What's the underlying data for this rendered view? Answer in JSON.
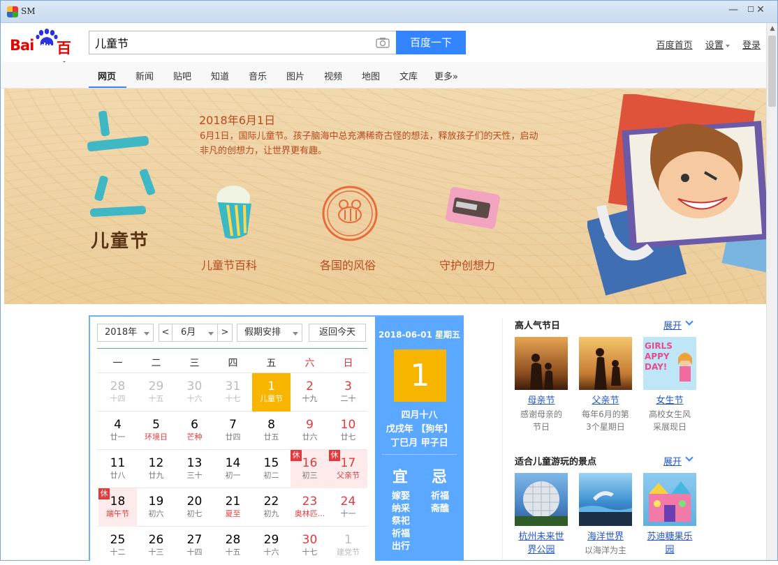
{
  "window": {
    "title": "SM",
    "min": "—",
    "max": "☐",
    "close": "✕"
  },
  "header": {
    "logo": {
      "text_bai": "Bai",
      "text_du": "du",
      "text_cn": "百度"
    },
    "search": {
      "value": "儿童节",
      "button": "百度一下"
    },
    "links": [
      "百度首页",
      "设置",
      "登录"
    ]
  },
  "nav": {
    "tabs": [
      "网页",
      "新闻",
      "贴吧",
      "知道",
      "音乐",
      "图片",
      "视频",
      "地图",
      "文库",
      "更多»"
    ]
  },
  "banner": {
    "date": "2018年6月1日",
    "desc": "6月1日，国际儿童节。孩子脑海中总充满稀奇古怪的想法，释放孩子们的天性，启动非凡的创想力，让世界更有趣。",
    "title": "儿童节",
    "links": [
      "儿童节百科",
      "各国的风俗",
      "守护创想力"
    ]
  },
  "calendar": {
    "year": "2018年",
    "prev": "<",
    "month": "6月",
    "next": ">",
    "holiday": "假期安排",
    "today_btn": "返回今天",
    "weekdays": [
      "一",
      "二",
      "三",
      "四",
      "五",
      "六",
      "日"
    ],
    "rest_mark": "休",
    "weeks": [
      [
        {
          "n": "28",
          "l": "十四",
          "t": "muted"
        },
        {
          "n": "29",
          "l": "十五",
          "t": "muted"
        },
        {
          "n": "30",
          "l": "十六",
          "t": "muted"
        },
        {
          "n": "31",
          "l": "十七",
          "t": "muted"
        },
        {
          "n": "1",
          "l": "儿童节",
          "t": "today"
        },
        {
          "n": "2",
          "l": "十九",
          "t": "weekend"
        },
        {
          "n": "3",
          "l": "二十",
          "t": "weekend"
        }
      ],
      [
        {
          "n": "4",
          "l": "廿一"
        },
        {
          "n": "5",
          "l": "环境日",
          "red": true
        },
        {
          "n": "6",
          "l": "芒种",
          "red": true
        },
        {
          "n": "7",
          "l": "廿四"
        },
        {
          "n": "8",
          "l": "廿五"
        },
        {
          "n": "9",
          "l": "廿六",
          "t": "weekend"
        },
        {
          "n": "10",
          "l": "廿七",
          "t": "weekend"
        }
      ],
      [
        {
          "n": "11",
          "l": "廿八"
        },
        {
          "n": "12",
          "l": "廿九"
        },
        {
          "n": "13",
          "l": "三十"
        },
        {
          "n": "14",
          "l": "初一"
        },
        {
          "n": "15",
          "l": "初二"
        },
        {
          "n": "16",
          "l": "初三",
          "t": "weekend",
          "h": true
        },
        {
          "n": "17",
          "l": "父亲节",
          "t": "weekend",
          "h": true,
          "red": true
        }
      ],
      [
        {
          "n": "18",
          "l": "端午节",
          "h": true,
          "red": true
        },
        {
          "n": "19",
          "l": "初六"
        },
        {
          "n": "20",
          "l": "初七"
        },
        {
          "n": "21",
          "l": "夏至",
          "red": true
        },
        {
          "n": "22",
          "l": "初九"
        },
        {
          "n": "23",
          "l": "奥林匹...",
          "t": "weekend",
          "red": true
        },
        {
          "n": "24",
          "l": "十一",
          "t": "weekend"
        }
      ],
      [
        {
          "n": "25",
          "l": "十二"
        },
        {
          "n": "26",
          "l": "十三"
        },
        {
          "n": "27",
          "l": "十四"
        },
        {
          "n": "28",
          "l": "十五"
        },
        {
          "n": "29",
          "l": "十六"
        },
        {
          "n": "30",
          "l": "十七",
          "t": "weekend"
        },
        {
          "n": "1",
          "l": "建党节",
          "t": "muted"
        }
      ]
    ],
    "side": {
      "date": "2018-06-01 星期五",
      "day": "1",
      "lunar": [
        "四月十八",
        "戊戌年 【狗年】",
        "丁巳月 甲子日"
      ],
      "yi": "宜",
      "ji": "忌",
      "yi_items": [
        "嫁娶",
        "纳采",
        "祭祀",
        "祈福",
        "出行"
      ],
      "ji_items": [
        "祈福",
        "斋醮"
      ]
    }
  },
  "sidebar": {
    "section1": {
      "title": "高人气节日",
      "more": "展开",
      "items": [
        {
          "name": "母亲节",
          "desc1": "感谢母亲的",
          "desc2": "节日"
        },
        {
          "name": "父亲节",
          "desc1": "每年6月的第",
          "desc2": "3个星期日"
        },
        {
          "name": "女生节",
          "desc1": "高校女生风",
          "desc2": "采展现日"
        }
      ],
      "thumb3_text": [
        "GIRLS",
        "APPY",
        "DAY!"
      ]
    },
    "section2": {
      "title": "适合儿童游玩的景点",
      "more": "展开",
      "items": [
        {
          "name1": "杭州未来世",
          "name2": "界公园"
        },
        {
          "name1": "海洋世界",
          "desc": "以海洋为主"
        },
        {
          "name1": "苏迪糖果乐",
          "name2": "园"
        }
      ]
    }
  }
}
